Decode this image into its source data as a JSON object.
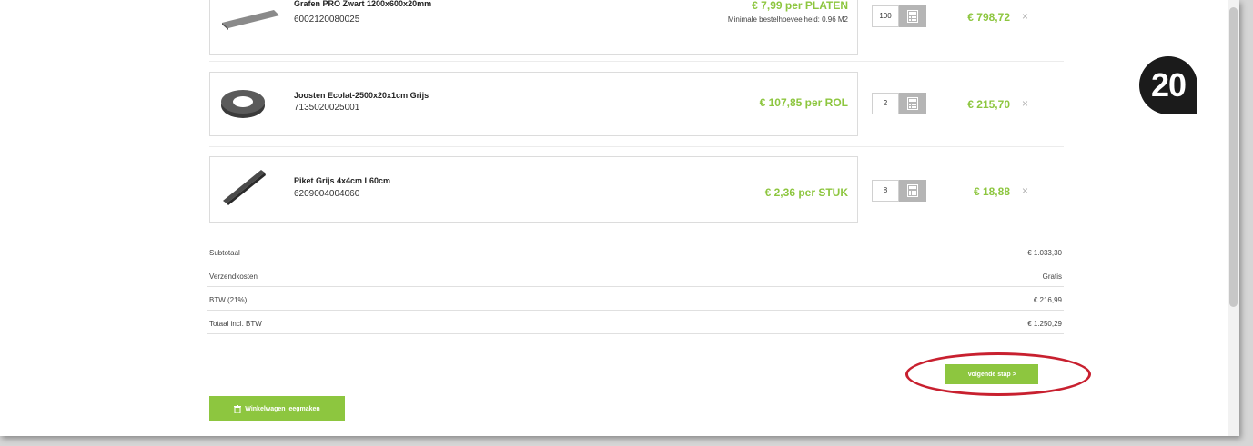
{
  "cart": {
    "items": [
      {
        "name": "Grafen PRO Zwart 1200x600x20mm",
        "sku": "6002120080025",
        "price": "€ 7,99 per PLATEN",
        "min_note": "Minimale bestelhoeveelheid: 0.96 M2",
        "qty": "100",
        "total": "€ 798,72",
        "icon": "board-icon"
      },
      {
        "name": "Joosten Ecolat-2500x20x1cm Grijs",
        "sku": "7135020025001",
        "price": "€ 107,85 per ROL",
        "qty": "2",
        "total": "€ 215,70",
        "icon": "edging-roll-icon"
      },
      {
        "name": "Piket Grijs 4x4cm L60cm",
        "sku": "6209004004060",
        "price": "€ 2,36 per STUK",
        "qty": "8",
        "total": "€ 18,88",
        "icon": "stake-icon"
      }
    ],
    "remove_symbol": "×"
  },
  "summary": {
    "subtotal_label": "Subtotaal",
    "subtotal_value": "€ 1.033,30",
    "shipping_label": "Verzendkosten",
    "shipping_value": "Gratis",
    "vat_label": "BTW (21%)",
    "vat_value": "€ 216,99",
    "total_label": "Totaal incl. BTW",
    "total_value": "€ 1.250,29"
  },
  "actions": {
    "next_step": "Volgende stap >",
    "clear_cart": "Winkelwagen leegmaken",
    "clear_icon": "trash-icon"
  },
  "annotation": {
    "step_number": "20",
    "highlight_color": "#c8202f"
  },
  "colors": {
    "accent_green": "#8dc63f",
    "calc_button": "#b5b5b5"
  }
}
